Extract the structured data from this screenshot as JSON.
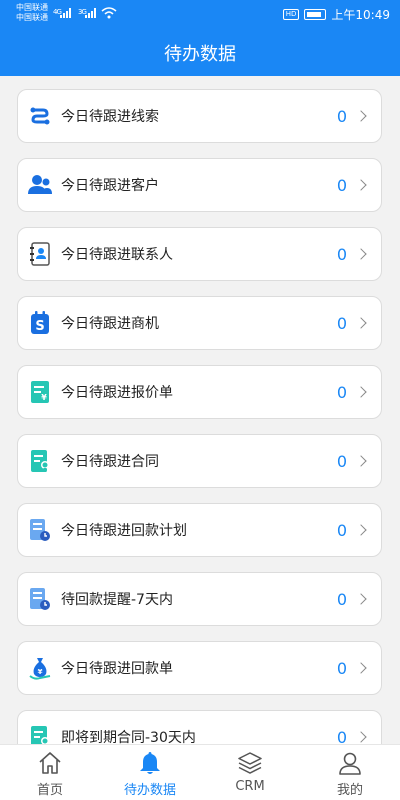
{
  "status": {
    "carrier1": "中国联通",
    "carrier2": "中国联通",
    "signal1": "4G",
    "signal2": "3G",
    "hd": "HD",
    "time": "上午10:49"
  },
  "header": {
    "title": "待办数据"
  },
  "items": [
    {
      "label": "今日待跟进线索",
      "count": "0",
      "icon": "lead-icon"
    },
    {
      "label": "今日待跟进客户",
      "count": "0",
      "icon": "customer-icon"
    },
    {
      "label": "今日待跟进联系人",
      "count": "0",
      "icon": "contact-book-icon"
    },
    {
      "label": "今日待跟进商机",
      "count": "0",
      "icon": "opportunity-icon"
    },
    {
      "label": "今日待跟进报价单",
      "count": "0",
      "icon": "quote-icon"
    },
    {
      "label": "今日待跟进合同",
      "count": "0",
      "icon": "contract-icon"
    },
    {
      "label": "今日待跟进回款计划",
      "count": "0",
      "icon": "payment-plan-icon"
    },
    {
      "label": "待回款提醒-7天内",
      "count": "0",
      "icon": "payment-reminder-icon"
    },
    {
      "label": "今日待跟进回款单",
      "count": "0",
      "icon": "money-bag-icon"
    },
    {
      "label": "即将到期合同-30天内",
      "count": "0",
      "icon": "expiring-contract-icon"
    }
  ],
  "tabs": [
    {
      "label": "首页",
      "icon": "home-icon",
      "active": false
    },
    {
      "label": "待办数据",
      "icon": "bell-icon",
      "active": true
    },
    {
      "label": "CRM",
      "icon": "layers-icon",
      "active": false
    },
    {
      "label": "我的",
      "icon": "user-icon",
      "active": false
    }
  ],
  "colors": {
    "primary": "#1a87f5",
    "teal": "#26c6b4",
    "background": "#f2f2f2"
  }
}
